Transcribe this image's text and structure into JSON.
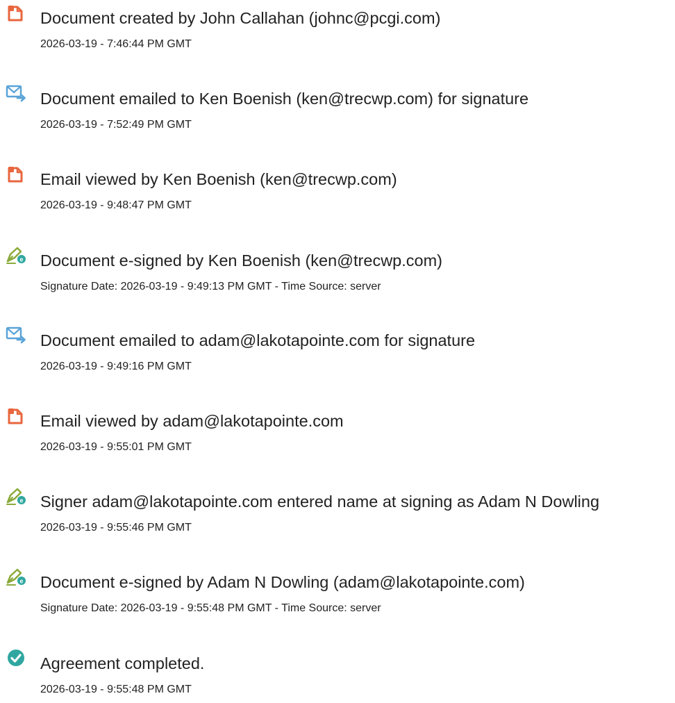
{
  "colors": {
    "document_icon": "#e8663d",
    "email_icon": "#5aa3d8",
    "esign_icon_pen": "#8aaa3a",
    "esign_icon_dot": "#2fa7a0",
    "complete_icon": "#2fa7a0",
    "text": "#222222"
  },
  "events": [
    {
      "icon": "document-icon",
      "title": "Document created by John Callahan (johnc@pcgi.com)",
      "time": "2026-03-19 - 7:46:44 PM GMT"
    },
    {
      "icon": "email-icon",
      "title": "Document emailed to Ken Boenish (ken@trecwp.com) for signature",
      "time": "2026-03-19 - 7:52:49 PM GMT"
    },
    {
      "icon": "document-icon",
      "title": "Email viewed by Ken Boenish (ken@trecwp.com)",
      "time": "2026-03-19 - 9:48:47 PM GMT"
    },
    {
      "icon": "esign-pen-icon",
      "title": "Document e-signed by Ken Boenish (ken@trecwp.com)",
      "time": "Signature Date: 2026-03-19 - 9:49:13 PM GMT - Time Source: server"
    },
    {
      "icon": "email-icon",
      "title": "Document emailed to adam@lakotapointe.com for signature",
      "time": "2026-03-19 - 9:49:16 PM GMT"
    },
    {
      "icon": "document-icon",
      "title": "Email viewed by adam@lakotapointe.com",
      "time": "2026-03-19 - 9:55:01 PM GMT"
    },
    {
      "icon": "esign-pen-icon",
      "title": "Signer adam@lakotapointe.com entered name at signing as Adam N Dowling",
      "time": "2026-03-19 - 9:55:46 PM GMT"
    },
    {
      "icon": "esign-pen-icon",
      "title": "Document e-signed by Adam N Dowling (adam@lakotapointe.com)",
      "time": "Signature Date: 2026-03-19 - 9:55:48 PM GMT - Time Source: server"
    },
    {
      "icon": "checkmark-circle-icon",
      "title": "Agreement completed.",
      "time": "2026-03-19 - 9:55:48 PM GMT"
    }
  ]
}
